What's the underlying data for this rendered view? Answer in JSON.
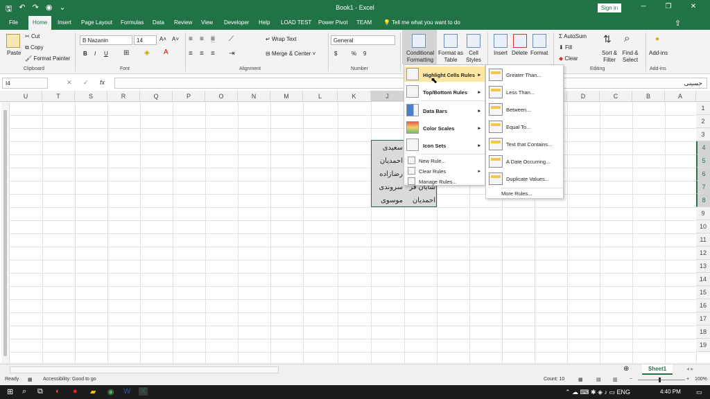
{
  "window": {
    "title": "Book1  -  Excel",
    "sign_in": "Sign in",
    "qat_icons": [
      "save-icon",
      "undo-icon",
      "redo-icon",
      "camera-icon",
      "customize-qat-icon"
    ],
    "controls": [
      "─",
      "❐",
      "─",
      "✕"
    ]
  },
  "tabs": [
    "File",
    "Home",
    "Insert",
    "Page Layout",
    "Formulas",
    "Data",
    "Review",
    "Developer",
    "Help",
    "LOAD TEST",
    "Power Pivot",
    "TEAM"
  ],
  "active_tab": "Home",
  "tell_me": "Tell me what you want to do",
  "ribbon": {
    "clipboard": {
      "label": "Clipboard",
      "paste": "Paste",
      "cut": "Cut",
      "copy": "Copy",
      "format_painter": "Format Painter"
    },
    "font": {
      "label": "Font",
      "name": "B Nazanin",
      "size": "14",
      "bold": "B",
      "italic": "I",
      "underline": "U"
    },
    "alignment": {
      "label": "Alignment",
      "wrap_text": "Wrap Text",
      "merge_center": "Merge & Center"
    },
    "number": {
      "label": "Number",
      "format": "General",
      "currency": "$",
      "percent": "%",
      "comma": "9"
    },
    "styles": {
      "conditional_formatting": "Conditional Formatting",
      "format_as_table": "Format as Table",
      "cell_styles": "Cell Styles"
    },
    "cells": {
      "insert": "Insert",
      "delete": "Delete",
      "format": "Format"
    },
    "editing": {
      "label": "Editing",
      "autosum": "AutoSum",
      "fill": "Fill",
      "clear": "Clear",
      "sort_filter": "Sort & Filter",
      "find_select": "Find & Select"
    },
    "addins": {
      "label": "Add-ins",
      "addins": "Add-ins"
    }
  },
  "formula_bar": {
    "name_box": "I4",
    "fx": "fx",
    "value": "حسینی"
  },
  "columns": [
    "U",
    "T",
    "S",
    "R",
    "Q",
    "P",
    "O",
    "N",
    "M",
    "L",
    "K",
    "J",
    "I",
    "H",
    "G",
    "F",
    "E",
    "D",
    "C",
    "B",
    "A"
  ],
  "rows": [
    "1",
    "2",
    "3",
    "4",
    "5",
    "6",
    "7",
    "8",
    "9",
    "10",
    "11",
    "12",
    "13",
    "14",
    "15",
    "16",
    "17",
    "18",
    "19"
  ],
  "cells": {
    "col_j": [
      "سعیدی",
      "احمدیان",
      "رضازاده",
      "سروندی",
      "موسوی"
    ],
    "col_i": [
      "",
      "",
      "",
      "شایان فر",
      "احمدیان"
    ]
  },
  "cf_menu": {
    "items": [
      {
        "label": "Highlight Cells Rules",
        "icon": "highlight-cells-icon",
        "arrow": "▸"
      },
      {
        "label": "Top/Bottom Rules",
        "icon": "top-bottom-icon",
        "arrow": "▸"
      },
      {
        "label": "Data Bars",
        "icon": "data-bars-icon",
        "arrow": "▸"
      },
      {
        "label": "Color Scales",
        "icon": "color-scales-icon",
        "arrow": "▸"
      },
      {
        "label": "Icon Sets",
        "icon": "icon-sets-icon",
        "arrow": "▸"
      }
    ],
    "small_items": [
      {
        "label": "New Rule...",
        "icon": "new-rule-icon"
      },
      {
        "label": "Clear Rules",
        "icon": "clear-rules-icon",
        "arrow": "▸"
      },
      {
        "label": "Manage Rules...",
        "icon": "manage-rules-icon"
      }
    ]
  },
  "submenu": {
    "items": [
      "Greater Than...",
      "Less Than...",
      "Between...",
      "Equal To...",
      "Text that Contains...",
      "A Date Occurring...",
      "Duplicate Values..."
    ],
    "more": "More Rules..."
  },
  "sheet_tabs": [
    "Sheet1"
  ],
  "status": {
    "ready": "Ready",
    "accessibility": "Accessibility: Good to go",
    "count": "Count: 10",
    "zoom": "100%"
  },
  "taskbar": {
    "time": "4:40 PM"
  },
  "colors": {
    "excel_green": "#217346",
    "hover": "#fce7a4"
  }
}
